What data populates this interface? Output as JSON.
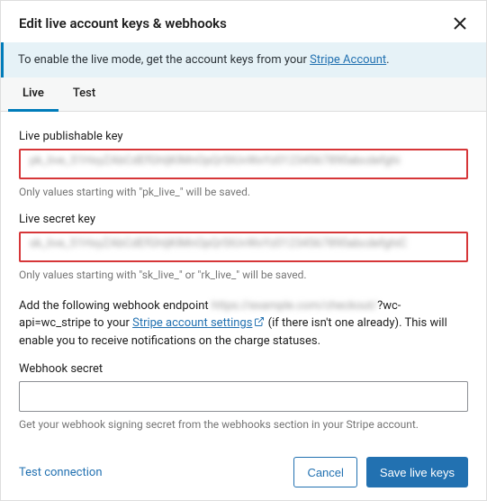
{
  "header": {
    "title": "Edit live account keys & webhooks"
  },
  "notice": {
    "text_prefix": "To enable the live mode, get the account keys from your ",
    "link_label": "Stripe Account",
    "text_suffix": "."
  },
  "tabs": {
    "live": "Live",
    "test": "Test"
  },
  "fields": {
    "pub_key": {
      "label": "Live publishable key",
      "value_blurred": "pk_live_51HxyZAbCdEfGhIjKlMnOpQrStUvWxYz01234567890abcdefghi",
      "helper": "Only values starting with \"pk_live_\" will be saved."
    },
    "secret_key": {
      "label": "Live secret key",
      "value_blurred": "sk_live_51HxyZAbCdEfGhIjKlMnOpQrStUvWxYz01234567890abcdefghiC",
      "helper": "Only values starting with \"sk_live_\" or \"rk_live_\" will be saved."
    },
    "webhook_info": {
      "prefix": "Add the following webhook endpoint ",
      "redacted_url": "https://example.com/checkout/",
      "visible_query": "?wc-api=wc_stripe",
      "mid": " to your ",
      "link_label": "Stripe account settings",
      "tail": " (if there isn't one already). This will enable you to receive notifications on the charge statuses."
    },
    "webhook_secret": {
      "label": "Webhook secret",
      "value": "",
      "helper": "Get your webhook signing secret from the webhooks section in your Stripe account."
    }
  },
  "footer": {
    "test_connection": "Test connection",
    "cancel": "Cancel",
    "save": "Save live keys"
  }
}
